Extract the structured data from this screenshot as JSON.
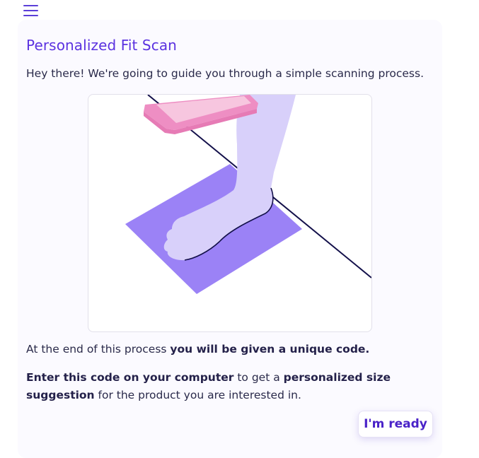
{
  "header": {
    "menu_icon": "hamburger-menu-icon"
  },
  "card": {
    "title": "Personalized Fit Scan",
    "intro": "Hey there! We're going to guide you through a simple scanning process.",
    "illustration": {
      "description_icon": "foot-scan-illustration",
      "colors": {
        "mat": "#9b82f6",
        "foot": "#d8d0fa",
        "phone": "#f08fc4",
        "phone_screen": "#f7c6df",
        "line": "#13104a"
      }
    },
    "paragraph1": {
      "text_before": "At the end of this process ",
      "bold": "you will be given a unique code."
    },
    "paragraph2": {
      "bold1": "Enter this code on your computer",
      "text_mid": " to get a ",
      "bold2": "personalized size suggestion",
      "text_after": " for the product you are interested in."
    },
    "ready_button": "I'm ready"
  },
  "colors": {
    "accent": "#5b32e0",
    "card_bg": "#fbfaff",
    "text": "#2a2a4a"
  }
}
